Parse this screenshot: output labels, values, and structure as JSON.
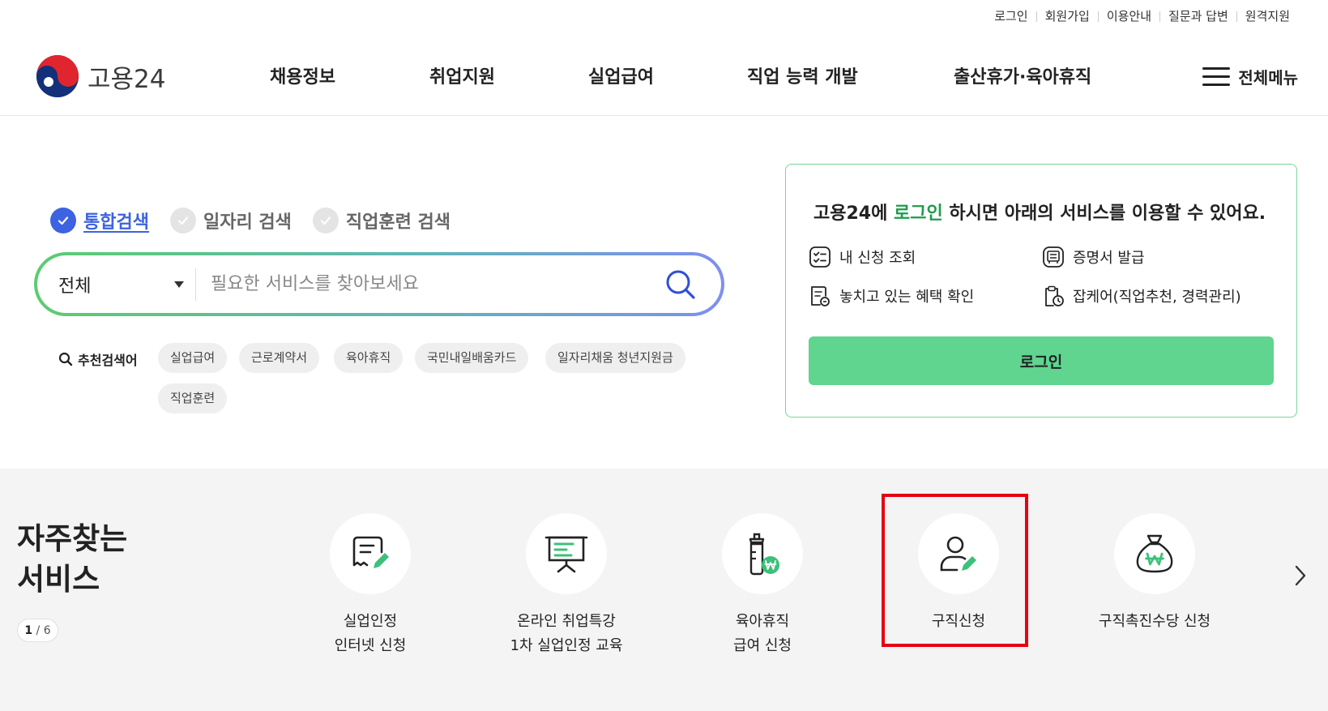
{
  "utility_links": [
    "로그인",
    "회원가입",
    "이용안내",
    "질문과 답변",
    "원격지원"
  ],
  "logo_text": "고용24",
  "gnb": [
    "채용정보",
    "취업지원",
    "실업급여",
    "직업 능력 개발",
    "출산휴가·육아휴직"
  ],
  "all_menu_label": "전체메뉴",
  "search_tabs": [
    {
      "label": "통합검색",
      "active": true
    },
    {
      "label": "일자리 검색",
      "active": false
    },
    {
      "label": "직업훈련 검색",
      "active": false
    }
  ],
  "search": {
    "category": "전체",
    "placeholder": "필요한 서비스를 찾아보세요",
    "value": ""
  },
  "recommend": {
    "label": "추천검색어",
    "keywords": [
      "실업급여",
      "근로계약서",
      "육아휴직",
      "국민내일배움카드",
      "일자리채움 청년지원금",
      "직업훈련"
    ]
  },
  "login_box": {
    "title_prefix": "고용24에 ",
    "title_highlight": "로그인",
    "title_suffix": " 하시면 아래의 서비스를 이용할 수 있어요.",
    "items": [
      "내 신청 조회",
      "증명서 발급",
      "놓치고 있는 혜택 확인",
      "잡케어(직업추천, 경력관리)"
    ],
    "button_label": "로그인"
  },
  "favorites": {
    "title_line1": "자주찾는",
    "title_line2": "서비스",
    "page_current": "1",
    "page_total": "6",
    "services": [
      {
        "line1": "실업인정",
        "line2": "인터넷 신청",
        "icon": "document-edit-icon"
      },
      {
        "line1": "온라인 취업특강",
        "line2": "1차 실업인정 교육",
        "icon": "presentation-board-icon"
      },
      {
        "line1": "육아휴직",
        "line2": "급여 신청",
        "icon": "baby-bottle-won-icon"
      },
      {
        "line1": "구직신청",
        "line2": "",
        "icon": "person-edit-icon"
      },
      {
        "line1": "구직촉진수당 신청",
        "line2": "",
        "icon": "money-bag-won-icon"
      }
    ],
    "highlighted_index": 3
  },
  "colors": {
    "brand_green": "#5fd590",
    "active_blue": "#3d63e0",
    "icon_green": "#3cc07a",
    "highlight_red": "#e60012"
  }
}
